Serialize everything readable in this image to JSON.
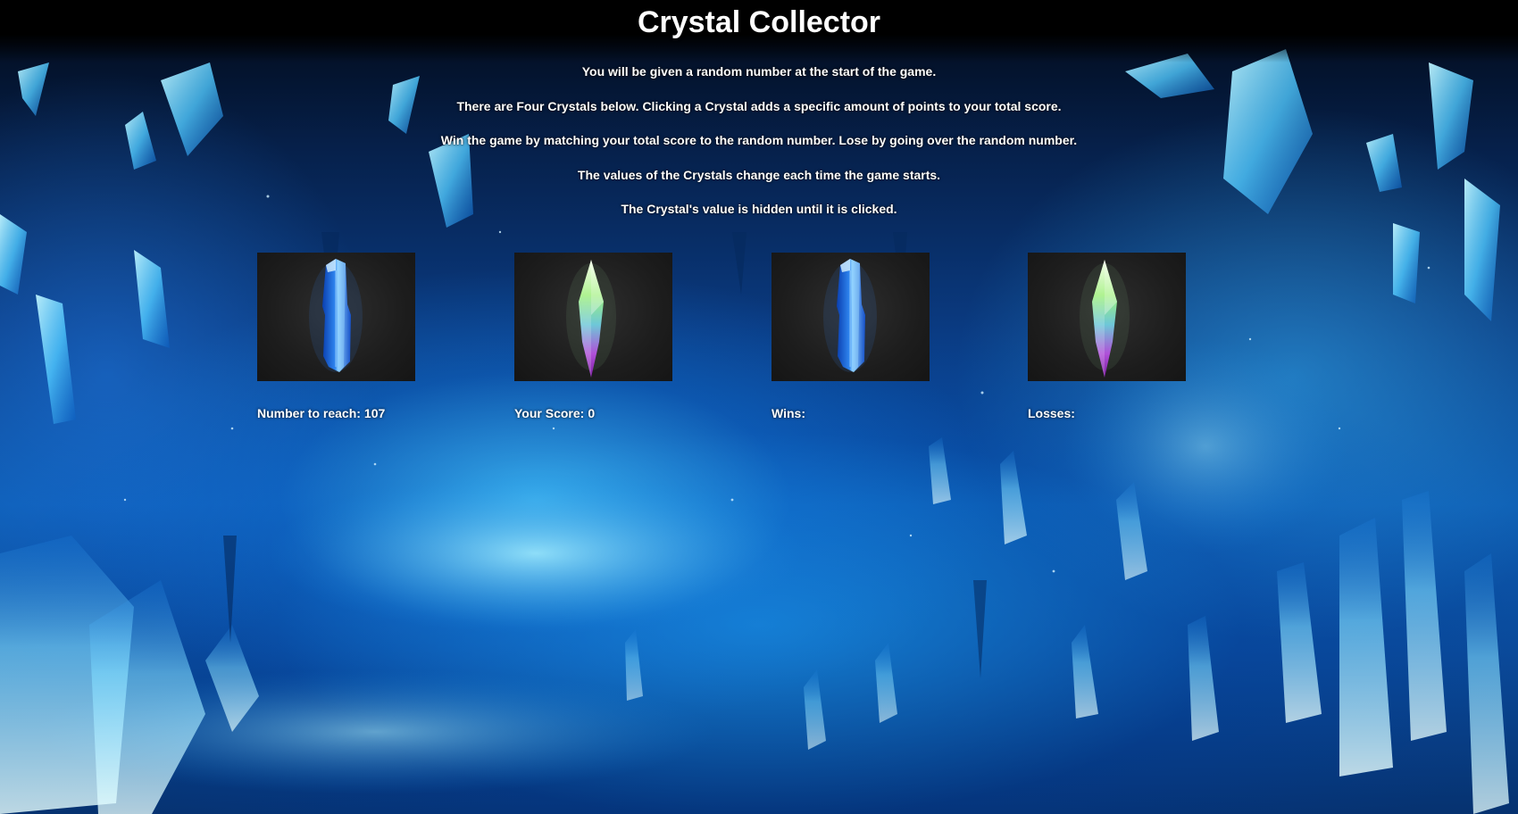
{
  "game": {
    "title": "Crystal Collector",
    "instructions": [
      "You will be given a random number at the start of the game.",
      "There are Four Crystals below. Clicking a Crystal adds a specific amount of points to your total score.",
      "Win the game by matching your total score to the random number. Lose by going over the random number.",
      "The values of the Crystals change each time the game starts.",
      "The Crystal's value is hidden until it is clicked."
    ]
  },
  "crystals": [
    {
      "name": "crystal-1",
      "style": "blue-column"
    },
    {
      "name": "crystal-2",
      "style": "rainbow-shard"
    },
    {
      "name": "crystal-3",
      "style": "blue-column"
    },
    {
      "name": "crystal-4",
      "style": "rainbow-shard"
    }
  ],
  "stats": {
    "target_label": "Number to reach:",
    "target_value": "107",
    "score_label": "Your Score:",
    "score_value": "0",
    "wins_label": "Wins:",
    "wins_value": "",
    "losses_label": "Losses:",
    "losses_value": ""
  },
  "colors": {
    "background_dark": "#020814",
    "cave_blue": "#0c5ab0",
    "glow_cyan": "#46c8ff",
    "crystal_tile": "#1d1d1d",
    "text": "#ffffff"
  }
}
